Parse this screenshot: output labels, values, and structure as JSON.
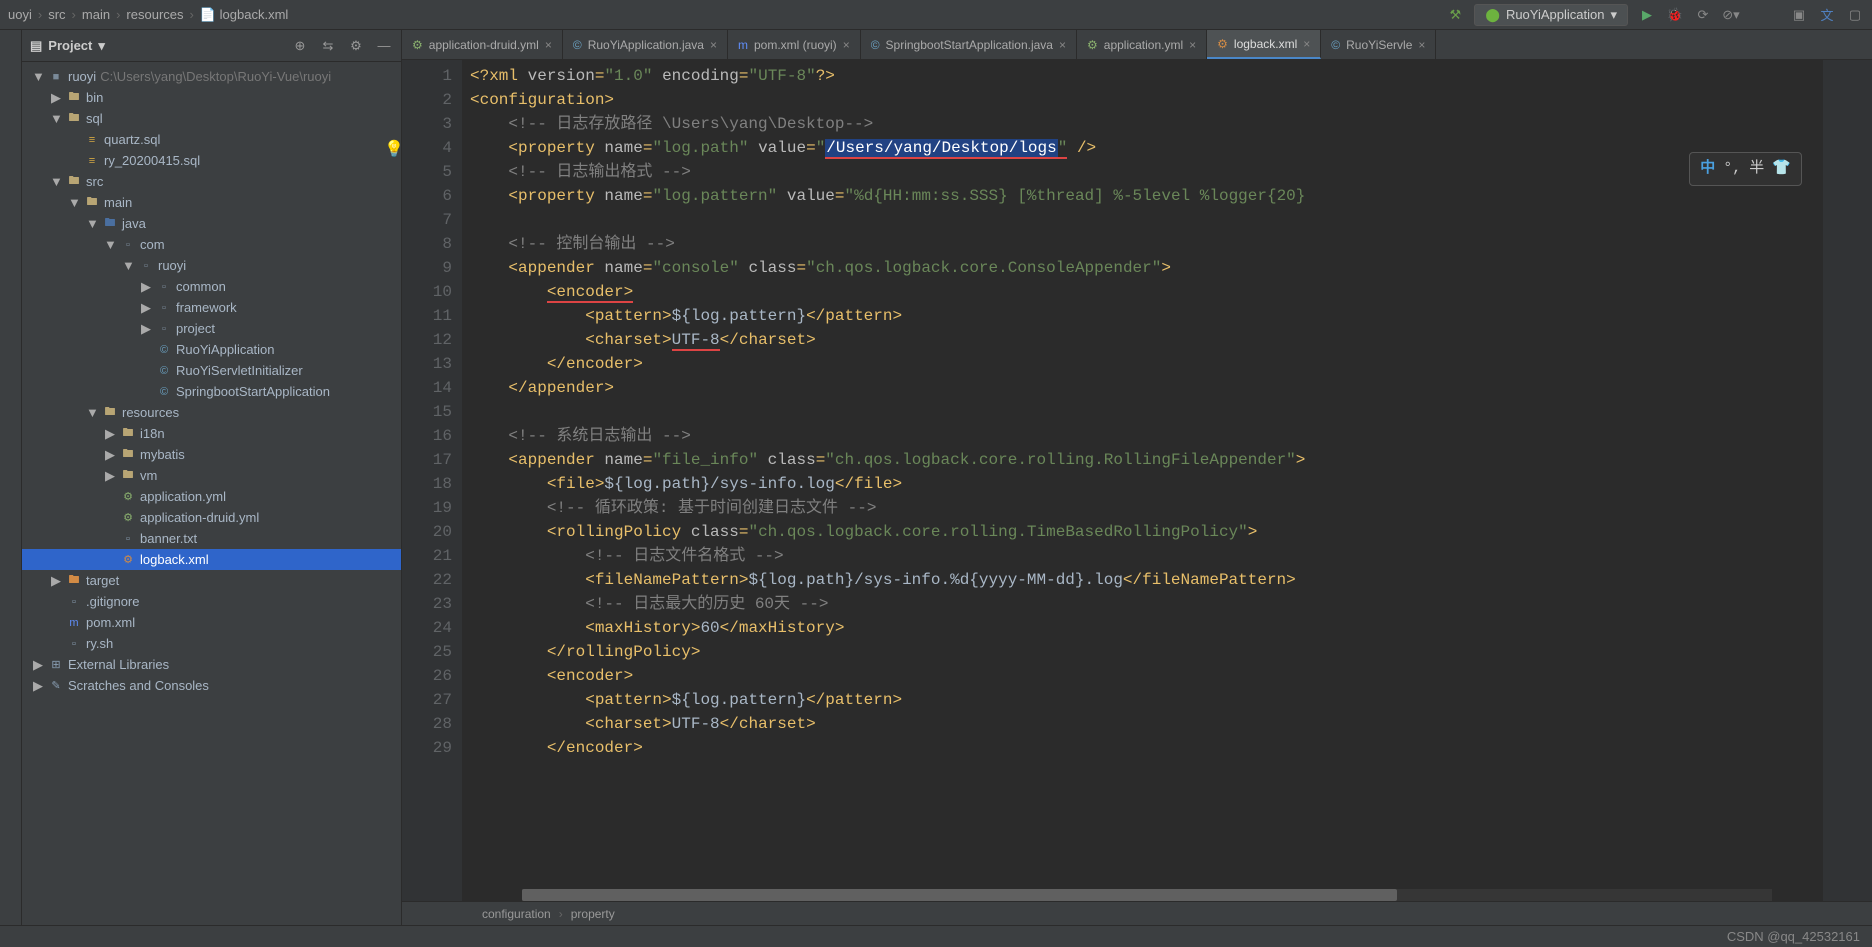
{
  "breadcrumbs": [
    "uoyi",
    "src",
    "main",
    "resources",
    "logback.xml"
  ],
  "runConfig": "RuoYiApplication",
  "projectPanel": {
    "title": "Project",
    "root": "ruoyi",
    "rootHint": "C:\\Users\\yang\\Desktop\\RuoYi-Vue\\ruoyi"
  },
  "tree": [
    {
      "depth": 0,
      "toggle": "▼",
      "icon": "module",
      "label": "ruoyi",
      "hint": "C:\\Users\\yang\\Desktop\\RuoYi-Vue\\ruoyi"
    },
    {
      "depth": 1,
      "toggle": "▶",
      "icon": "folder",
      "label": "bin"
    },
    {
      "depth": 1,
      "toggle": "▼",
      "icon": "folder",
      "label": "sql"
    },
    {
      "depth": 2,
      "toggle": "",
      "icon": "sql",
      "label": "quartz.sql"
    },
    {
      "depth": 2,
      "toggle": "",
      "icon": "sql",
      "label": "ry_20200415.sql"
    },
    {
      "depth": 1,
      "toggle": "▼",
      "icon": "folder",
      "label": "src"
    },
    {
      "depth": 2,
      "toggle": "▼",
      "icon": "folder",
      "label": "main"
    },
    {
      "depth": 3,
      "toggle": "▼",
      "icon": "folder-src",
      "label": "java"
    },
    {
      "depth": 4,
      "toggle": "▼",
      "icon": "package",
      "label": "com"
    },
    {
      "depth": 5,
      "toggle": "▼",
      "icon": "package",
      "label": "ruoyi"
    },
    {
      "depth": 6,
      "toggle": "▶",
      "icon": "package",
      "label": "common"
    },
    {
      "depth": 6,
      "toggle": "▶",
      "icon": "package",
      "label": "framework"
    },
    {
      "depth": 6,
      "toggle": "▶",
      "icon": "package",
      "label": "project"
    },
    {
      "depth": 6,
      "toggle": "",
      "icon": "java",
      "label": "RuoYiApplication"
    },
    {
      "depth": 6,
      "toggle": "",
      "icon": "java",
      "label": "RuoYiServletInitializer"
    },
    {
      "depth": 6,
      "toggle": "",
      "icon": "java",
      "label": "SpringbootStartApplication"
    },
    {
      "depth": 3,
      "toggle": "▼",
      "icon": "folder-res",
      "label": "resources"
    },
    {
      "depth": 4,
      "toggle": "▶",
      "icon": "folder",
      "label": "i18n"
    },
    {
      "depth": 4,
      "toggle": "▶",
      "icon": "folder",
      "label": "mybatis"
    },
    {
      "depth": 4,
      "toggle": "▶",
      "icon": "folder",
      "label": "vm"
    },
    {
      "depth": 4,
      "toggle": "",
      "icon": "yml",
      "label": "application.yml"
    },
    {
      "depth": 4,
      "toggle": "",
      "icon": "yml",
      "label": "application-druid.yml"
    },
    {
      "depth": 4,
      "toggle": "",
      "icon": "file",
      "label": "banner.txt"
    },
    {
      "depth": 4,
      "toggle": "",
      "icon": "xml",
      "label": "logback.xml",
      "selected": true
    },
    {
      "depth": 1,
      "toggle": "▶",
      "icon": "folder-orange",
      "label": "target"
    },
    {
      "depth": 1,
      "toggle": "",
      "icon": "file",
      "label": ".gitignore"
    },
    {
      "depth": 1,
      "toggle": "",
      "icon": "m",
      "label": "pom.xml"
    },
    {
      "depth": 1,
      "toggle": "",
      "icon": "file",
      "label": "ry.sh"
    },
    {
      "depth": 0,
      "toggle": "▶",
      "icon": "lib",
      "label": "External Libraries"
    },
    {
      "depth": 0,
      "toggle": "▶",
      "icon": "scratch",
      "label": "Scratches and Consoles"
    }
  ],
  "tabs": [
    {
      "icon": "yml",
      "label": "application-druid.yml"
    },
    {
      "icon": "java",
      "label": "RuoYiApplication.java"
    },
    {
      "icon": "m",
      "label": "pom.xml (ruoyi)"
    },
    {
      "icon": "java",
      "label": "SpringbootStartApplication.java"
    },
    {
      "icon": "yml",
      "label": "application.yml"
    },
    {
      "icon": "xml",
      "label": "logback.xml",
      "active": true
    },
    {
      "icon": "java",
      "label": "RuoYiServle"
    }
  ],
  "ime": {
    "left": "中",
    "mid": "°,",
    "right": "半",
    "shirt": "👕"
  },
  "codeLines": [
    {
      "n": 1,
      "html": "<span class='c-tag'>&lt;?xml </span><span class='c-attr'>version</span><span class='c-tag'>=</span><span class='c-str'>\"1.0\"</span> <span class='c-attr'>encoding</span><span class='c-tag'>=</span><span class='c-str'>\"UTF-8\"</span><span class='c-tag'>?&gt;</span>",
      "indent": 0
    },
    {
      "n": 2,
      "html": "<span class='c-tag'>&lt;configuration&gt;</span>",
      "indent": 0
    },
    {
      "n": 3,
      "html": "<span class='c-cmt'>&lt;!-- 日志存放路径 \\Users\\yang\\Desktop--&gt;</span>",
      "indent": 1
    },
    {
      "n": 4,
      "html": "<span class='c-tag'>&lt;property </span><span class='c-attr'>name</span><span class='c-tag'>=</span><span class='c-str'>\"log.path\"</span> <span class='c-attr'>value</span><span class='c-tag'>=</span><span class='c-str'>\"</span><span class='selected-text underline-red'>/Users/yang/Desktop/logs</span><span class='c-str underline-red'>\"</span> <span class='c-tag'>/&gt;</span>",
      "indent": 1,
      "bulb": true
    },
    {
      "n": 5,
      "html": "<span class='c-cmt'>&lt;!-- 日志输出格式 --&gt;</span>",
      "indent": 1
    },
    {
      "n": 6,
      "html": "<span class='c-tag'>&lt;property </span><span class='c-attr'>name</span><span class='c-tag'>=</span><span class='c-str'>\"log.pattern\"</span> <span class='c-attr'>value</span><span class='c-tag'>=</span><span class='c-str'>\"%d{HH:mm:ss.SSS} [%thread] %-5level %logger{20}</span>",
      "indent": 1
    },
    {
      "n": 7,
      "html": "",
      "indent": 0
    },
    {
      "n": 8,
      "html": "<span class='c-cmt'>&lt;!-- 控制台输出 --&gt;</span>",
      "indent": 1
    },
    {
      "n": 9,
      "html": "<span class='c-tag'>&lt;appender </span><span class='c-attr'>name</span><span class='c-tag'>=</span><span class='c-str'>\"console\"</span> <span class='c-attr'>class</span><span class='c-tag'>=</span><span class='c-str'>\"ch.qos.logback.core.ConsoleAppender\"</span><span class='c-tag'>&gt;</span>",
      "indent": 1
    },
    {
      "n": 10,
      "html": "<span class='c-tag underline-red'>&lt;encoder&gt;</span>",
      "indent": 2
    },
    {
      "n": 11,
      "html": "<span class='c-tag'>&lt;pattern&gt;</span><span class='c-txt'>${log.pattern}</span><span class='c-tag'>&lt;/pattern&gt;</span>",
      "indent": 3
    },
    {
      "n": 12,
      "html": "<span class='c-tag'>&lt;charset&gt;</span><span class='c-txt underline-red'>UTF-8</span><span class='c-tag'>&lt;/charset&gt;</span>",
      "indent": 3
    },
    {
      "n": 13,
      "html": "<span class='c-tag'>&lt;/encoder&gt;</span>",
      "indent": 2
    },
    {
      "n": 14,
      "html": "<span class='c-tag'>&lt;/appender&gt;</span>",
      "indent": 1
    },
    {
      "n": 15,
      "html": "",
      "indent": 0
    },
    {
      "n": 16,
      "html": "<span class='c-cmt'>&lt;!-- 系统日志输出 --&gt;</span>",
      "indent": 1
    },
    {
      "n": 17,
      "html": "<span class='c-tag'>&lt;appender </span><span class='c-attr'>name</span><span class='c-tag'>=</span><span class='c-str'>\"file_info\"</span> <span class='c-attr'>class</span><span class='c-tag'>=</span><span class='c-str'>\"ch.qos.logback.core.rolling.RollingFileAppender\"</span><span class='c-tag'>&gt;</span>",
      "indent": 1
    },
    {
      "n": 18,
      "html": "<span class='c-tag'>&lt;file&gt;</span><span class='c-txt'>${log.path}/sys-info.log</span><span class='c-tag'>&lt;/file&gt;</span>",
      "indent": 2
    },
    {
      "n": 19,
      "html": "<span class='c-cmt'>&lt;!-- 循环政策: 基于时间创建日志文件 --&gt;</span>",
      "indent": 2
    },
    {
      "n": 20,
      "html": "<span class='c-tag'>&lt;rollingPolicy </span><span class='c-attr'>class</span><span class='c-tag'>=</span><span class='c-str'>\"ch.qos.logback.core.rolling.TimeBasedRollingPolicy\"</span><span class='c-tag'>&gt;</span>",
      "indent": 2
    },
    {
      "n": 21,
      "html": "<span class='c-cmt'>&lt;!-- 日志文件名格式 --&gt;</span>",
      "indent": 3
    },
    {
      "n": 22,
      "html": "<span class='c-tag'>&lt;fileNamePattern&gt;</span><span class='c-txt'>${log.path}/sys-info.%d{yyyy-MM-dd}.log</span><span class='c-tag'>&lt;/fileNamePattern&gt;</span>",
      "indent": 3
    },
    {
      "n": 23,
      "html": "<span class='c-cmt'>&lt;!-- 日志最大的历史 60天 --&gt;</span>",
      "indent": 3
    },
    {
      "n": 24,
      "html": "<span class='c-tag'>&lt;maxHistory&gt;</span><span class='c-txt'>60</span><span class='c-tag'>&lt;/maxHistory&gt;</span>",
      "indent": 3
    },
    {
      "n": 25,
      "html": "<span class='c-tag'>&lt;/rollingPolicy&gt;</span>",
      "indent": 2
    },
    {
      "n": 26,
      "html": "<span class='c-tag'>&lt;encoder&gt;</span>",
      "indent": 2
    },
    {
      "n": 27,
      "html": "<span class='c-tag'>&lt;pattern&gt;</span><span class='c-txt'>${log.pattern}</span><span class='c-tag'>&lt;/pattern&gt;</span>",
      "indent": 3
    },
    {
      "n": 28,
      "html": "<span class='c-tag'>&lt;charset&gt;</span><span class='c-txt'>UTF-8</span><span class='c-tag'>&lt;/charset&gt;</span>",
      "indent": 3
    },
    {
      "n": 29,
      "html": "<span class='c-tag'>&lt;/encoder&gt;</span>",
      "indent": 2
    }
  ],
  "bottomBreadcrumb": [
    "configuration",
    "property"
  ],
  "watermark": "CSDN @qq_42532161"
}
